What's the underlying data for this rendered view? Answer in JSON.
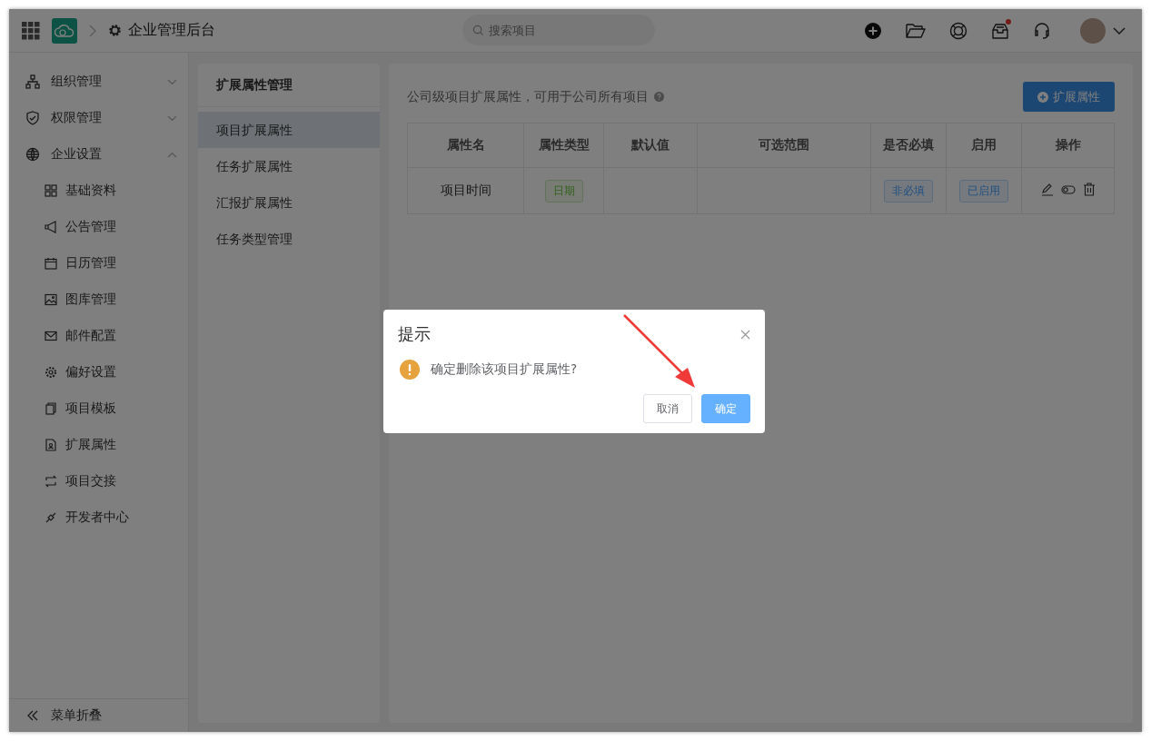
{
  "topbar": {
    "title": "企业管理后台",
    "search": {
      "placeholder": "搜索项目"
    },
    "notification_dot": true
  },
  "sidebar": {
    "items": [
      {
        "label": "组织管理",
        "expanded": false
      },
      {
        "label": "权限管理",
        "expanded": false
      },
      {
        "label": "企业设置",
        "expanded": true,
        "children": [
          {
            "label": "基础资料"
          },
          {
            "label": "公告管理"
          },
          {
            "label": "日历管理"
          },
          {
            "label": "图库管理"
          },
          {
            "label": "邮件配置"
          },
          {
            "label": "偏好设置"
          },
          {
            "label": "项目模板"
          },
          {
            "label": "扩展属性"
          },
          {
            "label": "项目交接"
          },
          {
            "label": "开发者中心"
          }
        ]
      }
    ],
    "collapse_label": "菜单折叠"
  },
  "subnav": {
    "title": "扩展属性管理",
    "items": [
      {
        "label": "项目扩展属性",
        "selected": true
      },
      {
        "label": "任务扩展属性",
        "selected": false
      },
      {
        "label": "汇报扩展属性",
        "selected": false
      },
      {
        "label": "任务类型管理",
        "selected": false
      }
    ]
  },
  "main": {
    "description": "公司级项目扩展属性，可用于公司所有项目",
    "add_button": "扩展属性",
    "table": {
      "columns": [
        "属性名",
        "属性类型",
        "默认值",
        "可选范围",
        "是否必填",
        "启用",
        "操作"
      ],
      "rows": [
        {
          "name": "项目时间",
          "type": "日期",
          "required": "非必填",
          "status": "已启用"
        }
      ]
    }
  },
  "dialog": {
    "title": "提示",
    "message": "确定删除该项目扩展属性?",
    "buttons": [
      {
        "label": "取消",
        "kind": "secondary"
      },
      {
        "label": "确定",
        "kind": "primary"
      }
    ]
  }
}
